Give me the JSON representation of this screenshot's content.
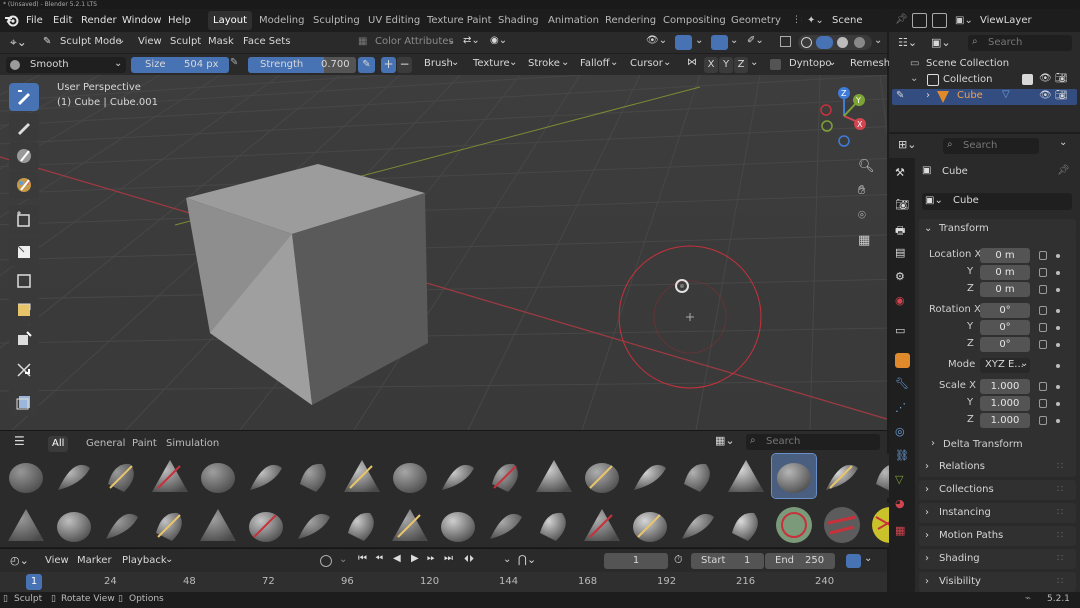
{
  "window": {
    "title": "* (Unsaved) - Blender 5.2.1 LTS"
  },
  "menu": {
    "file": "File",
    "edit": "Edit",
    "render": "Render",
    "window": "Window",
    "help": "Help"
  },
  "workspaces": [
    "Layout",
    "Modeling",
    "Sculpting",
    "UV Editing",
    "Texture Paint",
    "Shading",
    "Animation",
    "Rendering",
    "Compositing",
    "Geometry Nod"
  ],
  "scene": {
    "name": "Scene"
  },
  "view_layer": {
    "name": "ViewLayer"
  },
  "viewport_header": {
    "mode": "Sculpt Mode",
    "menus": [
      "View",
      "Sculpt",
      "Mask",
      "Face Sets"
    ],
    "color_attributes": "Color Attributes"
  },
  "tool_settings": {
    "brush_name": "Smooth",
    "size_label": "Size",
    "size_value": "504 px",
    "strength_label": "Strength",
    "strength_value": "0.700",
    "strength_fraction": 0.7,
    "dropdowns": [
      "Brush",
      "Texture",
      "Stroke",
      "Falloff",
      "Cursor"
    ],
    "axes": [
      "X",
      "Y",
      "Z"
    ],
    "dyntopo": "Dyntopo",
    "remesh": "Remesh"
  },
  "viewport": {
    "view_name": "User Perspective",
    "object_info": "(1) Cube | Cube.001",
    "gizmo": {
      "x": "X",
      "y": "Y",
      "z": "Z"
    }
  },
  "asset_shelf": {
    "tabs": [
      "All",
      "General",
      "Paint",
      "Simulation"
    ],
    "active_tab": "All",
    "search_placeholder": "Search",
    "selected_index": 16
  },
  "timeline": {
    "menus": [
      "View",
      "Marker",
      "Playback"
    ],
    "current_frame": "1",
    "start_label": "Start",
    "start_value": "1",
    "end_label": "End",
    "end_value": "250",
    "frame_marker": "1",
    "ticks": [
      "24",
      "48",
      "72",
      "96",
      "120",
      "144",
      "168",
      "192",
      "216",
      "240"
    ]
  },
  "status": {
    "items": [
      "Sculpt",
      "Rotate View",
      "Options"
    ],
    "version": "5.2.1"
  },
  "outliner": {
    "search_placeholder": "Search",
    "scene_collection": "Scene Collection",
    "collection": "Collection",
    "object": "Cube"
  },
  "properties": {
    "search_placeholder": "Search",
    "object_name": "Cube",
    "data_name": "Cube",
    "transform_label": "Transform",
    "location_label": "Location X",
    "location": [
      "0 m",
      "0 m",
      "0 m"
    ],
    "rotation_label": "Rotation X",
    "rotation": [
      "0°",
      "0°",
      "0°"
    ],
    "mode_label": "Mode",
    "mode_value": "XYZ E...",
    "scale_label": "Scale X",
    "scale": [
      "1.000",
      "1.000",
      "1.000"
    ],
    "y_label": "Y",
    "z_label": "Z",
    "delta_transform": "Delta Transform",
    "sections": [
      "Relations",
      "Collections",
      "Instancing",
      "Motion Paths",
      "Shading",
      "Visibility"
    ]
  },
  "colors": {
    "accent": "#4772b3",
    "x_axis": "#d0454f",
    "y_axis": "#7ea335",
    "z_axis": "#3f7bd9",
    "brush_circle": "#c8313c"
  }
}
